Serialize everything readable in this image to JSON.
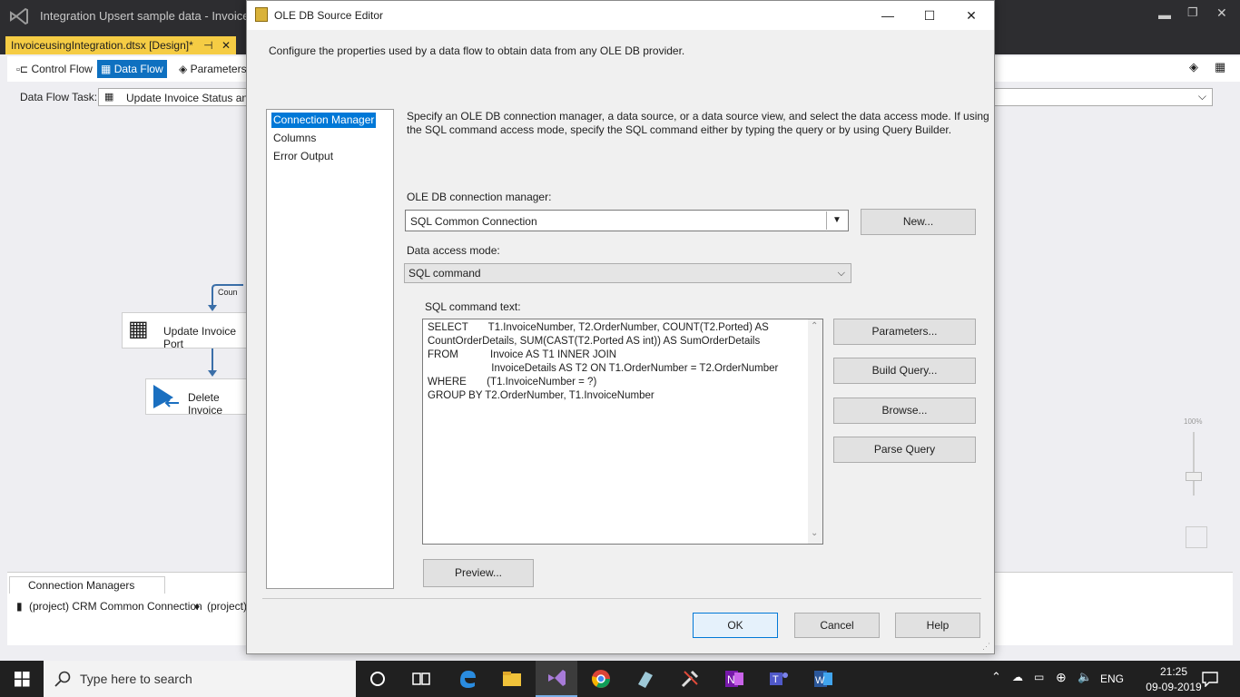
{
  "vs": {
    "title": "Integration Upsert sample data - Invoiceusi",
    "doc_tab": "InvoiceusingIntegration.dtsx [Design]*",
    "doc_tab_pin": "⊣",
    "toolbar": {
      "control_flow": "Control Flow",
      "data_flow": "Data Flow",
      "parameters": "Parameters"
    },
    "data_flow_task_label": "Data Flow Task:",
    "data_flow_task_value": "Update Invoice Status and I",
    "canvas": {
      "edge_label": "Coun",
      "node1": "Update Invoice Port",
      "node2": "Delete Invoice"
    },
    "zoom_label": "100%",
    "conn_managers_tab": "Connection Managers",
    "conn1": "(project) CRM Common Connection",
    "conn2": "(project)"
  },
  "dialog": {
    "title": "OLE DB Source Editor",
    "description": "Configure the properties used by a data flow to obtain data from any OLE DB provider.",
    "nav": [
      "Connection Manager",
      "Columns",
      "Error Output"
    ],
    "intro_line1": "Specify an OLE DB connection manager, a data source, or a data source view, and select the data access mode. If using",
    "intro_line2": "the SQL command access mode, specify the SQL command either by typing the query or by using Query Builder.",
    "conn_mgr_label": "OLE DB connection manager:",
    "conn_mgr_value": "SQL Common Connection",
    "new_button": "New...",
    "access_mode_label": "Data access mode:",
    "access_mode_value": "SQL command",
    "sql_label": "SQL command text:",
    "sql_text": "SELECT       T1.InvoiceNumber, T2.OrderNumber, COUNT(T2.Ported) AS\nCountOrderDetails, SUM(CAST(T2.Ported AS int)) AS SumOrderDetails\nFROM           Invoice AS T1 INNER JOIN\n                      InvoiceDetails AS T2 ON T1.OrderNumber = T2.OrderNumber\nWHERE       (T1.InvoiceNumber = ?)\nGROUP BY T2.OrderNumber, T1.InvoiceNumber",
    "parameters_button": "Parameters...",
    "build_query_button": "Build Query...",
    "browse_button": "Browse...",
    "parse_query_button": "Parse Query",
    "preview_button": "Preview...",
    "ok_button": "OK",
    "cancel_button": "Cancel",
    "help_button": "Help"
  },
  "taskbar": {
    "search_placeholder": "Type here to search",
    "language": "ENG",
    "time": "21:25",
    "date": "09-09-2019"
  },
  "colors": {
    "accent": "#0078d7",
    "vs_dark": "#2d2d30",
    "doc_tab": "#f5cc44"
  }
}
